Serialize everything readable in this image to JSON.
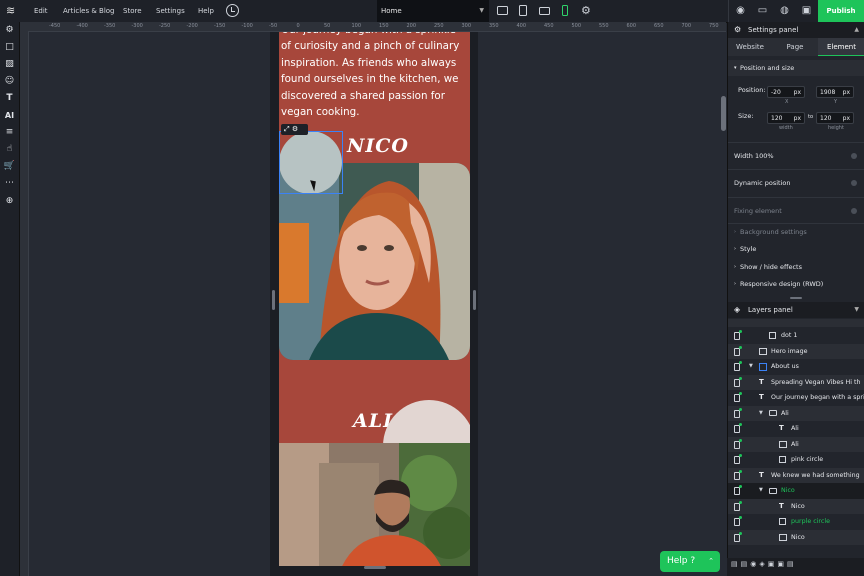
{
  "topbar": {
    "menu": [
      "Edit",
      "Articles & Blog",
      "Store",
      "Settings",
      "Help"
    ],
    "page_select": "Home",
    "publish": "Publish"
  },
  "ruler": {
    "top": [
      "-450",
      "-400",
      "-350",
      "-300",
      "-250",
      "-200",
      "-150",
      "-100",
      "-50",
      "0",
      "50",
      "100",
      "150",
      "200",
      "250",
      "300",
      "350",
      "400",
      "450",
      "500",
      "550",
      "600",
      "650",
      "700",
      "750",
      "800"
    ]
  },
  "canvas": {
    "intro_text": "Our journey began with a sprinkle of curiosity and a pinch of culinary inspiration. As friends who always found ourselves in the kitchen, we discovered a shared passion for vegan cooking.",
    "name_1": "NICO",
    "name_2": "ALI"
  },
  "settings_panel": {
    "title": "Settings panel",
    "tabs": [
      "Website",
      "Page",
      "Element"
    ],
    "active_tab": "Element",
    "position_size": {
      "header": "Position and size",
      "position_label": "Position:",
      "pos_x": "-20",
      "pos_y": "1908",
      "unit": "px",
      "x_label": "X",
      "y_label": "Y",
      "size_label": "Size:",
      "width": "120",
      "height": "120",
      "to": "to",
      "width_label": "width",
      "height_label": "height"
    },
    "width_100": "Width 100%",
    "dynamic_position": "Dynamic position",
    "fixing_element": "Fixing element",
    "background_settings": "Background settings",
    "style": "Style",
    "show_hide": "Show / hide effects",
    "responsive": "Responsive design (RWD)"
  },
  "layers_panel": {
    "title": "Layers panel",
    "items": [
      {
        "type": "box",
        "label": "dot 1",
        "indent": 2
      },
      {
        "type": "image",
        "label": "Hero image",
        "indent": 1
      },
      {
        "type": "section",
        "label": "About us",
        "indent": 1,
        "expanded": true
      },
      {
        "type": "text",
        "label": "Spreading Vegan Vibes   Hi th",
        "indent": 1
      },
      {
        "type": "text",
        "label": "Our journey began with a sprin",
        "indent": 1
      },
      {
        "type": "folder",
        "label": "Ali",
        "indent": 2,
        "expanded": true
      },
      {
        "type": "text",
        "label": "Ali",
        "indent": 3
      },
      {
        "type": "image",
        "label": "Ali",
        "indent": 3
      },
      {
        "type": "box",
        "label": "pink circle",
        "indent": 3
      },
      {
        "type": "text",
        "label": "We knew we had something",
        "indent": 1
      },
      {
        "type": "folder",
        "label": "Nico",
        "indent": 2,
        "expanded": true,
        "selected": true
      },
      {
        "type": "text",
        "label": "Nico",
        "indent": 3
      },
      {
        "type": "box",
        "label": "purple circle",
        "indent": 3,
        "highlight": true
      },
      {
        "type": "image",
        "label": "Nico",
        "indent": 3
      }
    ]
  },
  "help_button": "Help ?",
  "colors": {
    "accent": "#1ec45a",
    "page_bg": "#a7473b",
    "circle_grey": "#b7c3c3",
    "circle_pink": "#e2d6d2"
  }
}
